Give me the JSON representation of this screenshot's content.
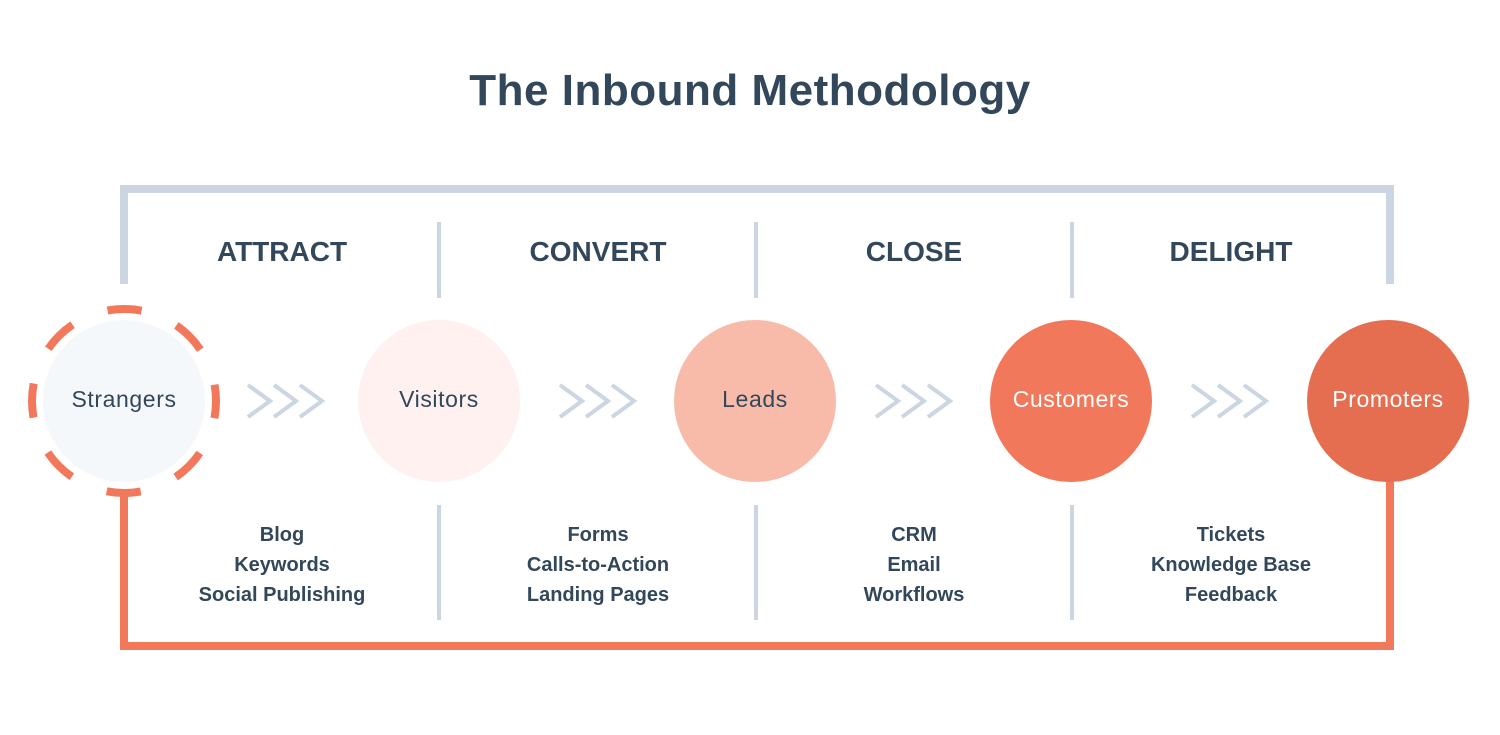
{
  "title": "The Inbound Methodology",
  "stages": [
    {
      "label": "ATTRACT",
      "tools": [
        "Blog",
        "Keywords",
        "Social Publishing"
      ]
    },
    {
      "label": "CONVERT",
      "tools": [
        "Forms",
        "Calls-to-Action",
        "Landing Pages"
      ]
    },
    {
      "label": "CLOSE",
      "tools": [
        "CRM",
        "Email",
        "Workflows"
      ]
    },
    {
      "label": "DELIGHT",
      "tools": [
        "Tickets",
        "Knowledge Base",
        "Feedback"
      ]
    }
  ],
  "nodes": [
    {
      "label": "Strangers",
      "fill": "#f5f8fb",
      "text_color": "#33475b",
      "outline": "dashed",
      "outline_color": "#f2785c"
    },
    {
      "label": "Visitors",
      "fill": "#fef1ef",
      "text_color": "#33475b"
    },
    {
      "label": "Leads",
      "fill": "#f8bbaa",
      "text_color": "#33475b"
    },
    {
      "label": "Customers",
      "fill": "#f2785c",
      "text_color": "#ffffff"
    },
    {
      "label": "Promoters",
      "fill": "#e66e50",
      "text_color": "#ffffff"
    }
  ],
  "colors": {
    "top_bracket": "#cbd6e2",
    "bottom_bracket": "#f2785c",
    "dividers": "#cbd6e2",
    "chevrons": "#cbd6e2",
    "text": "#33475b"
  }
}
